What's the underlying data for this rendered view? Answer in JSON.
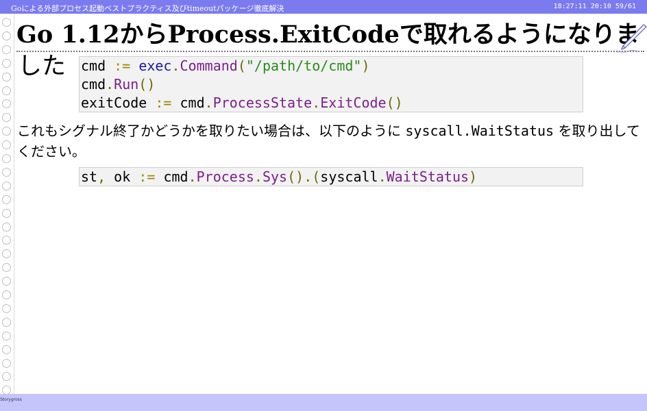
{
  "header": {
    "title": "Goによる外部プロセス起動ベストプラクティス及びtimeoutパッケージ徹底解決",
    "clock": "18:27:11",
    "elapsed": "20:10",
    "page": "59/61"
  },
  "slide": {
    "title_line1": "Go 1.12からProcess.ExitCodeで取れるようになりま",
    "title_line2": "した",
    "code1": {
      "line1": {
        "a": "cmd ",
        "op": ":=",
        "sp": " ",
        "pk": "exec",
        "dot": ".",
        "fn": "Command",
        "p1": "(",
        "str": "\"/path/to/cmd\"",
        "p2": ")"
      },
      "line2": {
        "a": "cmd",
        "dot": ".",
        "fn": "Run",
        "paren": "()"
      },
      "line3": {
        "a": "exitCode ",
        "op": ":=",
        "b": " cmd",
        "dot1": ".",
        "fn1": "ProcessState",
        "dot2": ".",
        "fn2": "ExitCode",
        "paren": "()"
      }
    },
    "para_before": "これもシグナル終了かどうかを取りたい場合は、以下のように ",
    "para_code": "syscall.WaitStatus",
    "para_after": " を取り出してください。",
    "code2": {
      "line1": {
        "a": "st",
        "comma": ",",
        "b": " ok ",
        "op": ":=",
        "c": " cmd",
        "dot1": ".",
        "fn1": "Process",
        "dot2": ".",
        "fn2": "Sys",
        "p": "()",
        "dot3": ".",
        "p1": "(",
        "d": "syscall",
        "dot4": ".",
        "fn3": "WaitStatus",
        "p2": ")"
      }
    }
  },
  "footer": {
    "label": "Storygross"
  },
  "colors": {
    "header_bg": "#7b7bf0",
    "footer_bg": "#c5c5fb",
    "code_bg": "#f2f2f2"
  },
  "icons": {
    "corner": "pen-icon"
  }
}
